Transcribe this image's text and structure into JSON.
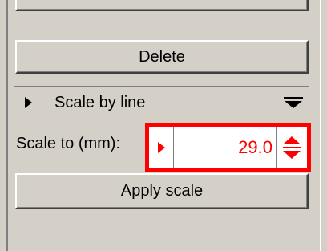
{
  "panel": {
    "delete_label": "Delete",
    "mode": {
      "label": "Scale by line"
    },
    "scale_field": {
      "label": "Scale to (mm):",
      "value": "29.0"
    },
    "apply_label": "Apply scale"
  },
  "colors": {
    "highlight": "#ff0000",
    "background": "#d4d0c8"
  }
}
